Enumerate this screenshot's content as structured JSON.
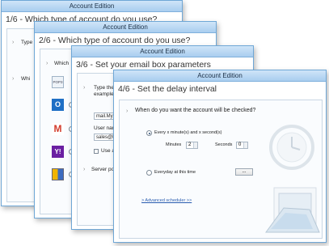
{
  "window_title": "Account Edition",
  "windows": [
    {
      "step": "1/6 - Which type of account do you use?",
      "question": "Type",
      "extra": "Whi"
    },
    {
      "step": "2/6 - Which type of account do you use?",
      "question": "Which",
      "pop_label": "POP3"
    },
    {
      "step": "3/6 - Set your email box parameters",
      "type_label": "Type the",
      "example_label": "example: p",
      "email_value": "mail.MyD",
      "user_label": "User nam",
      "user_value": "sales@My",
      "use_label": "Use a",
      "server_label": "Server por"
    },
    {
      "step": "4/6 - Set the delay interval",
      "question": "When do you want the account will be checked?",
      "option_interval": "Every x minute(s) and x second(s)",
      "minutes_label": "Minutes",
      "minutes_value": "2",
      "seconds_label": "Seconds",
      "seconds_value": "0",
      "option_everyday": "Everyday at this time",
      "time_value": "...",
      "advanced_link": "> Advanced scheduler >>"
    }
  ],
  "colors": {
    "accent": "#6fa7d6",
    "link": "#2a5db0"
  },
  "icons": [
    "pop3-icon",
    "outlook-icon",
    "gmail-icon",
    "yahoo-icon",
    "other-mail-icon",
    "calendar-clock-icon"
  ]
}
